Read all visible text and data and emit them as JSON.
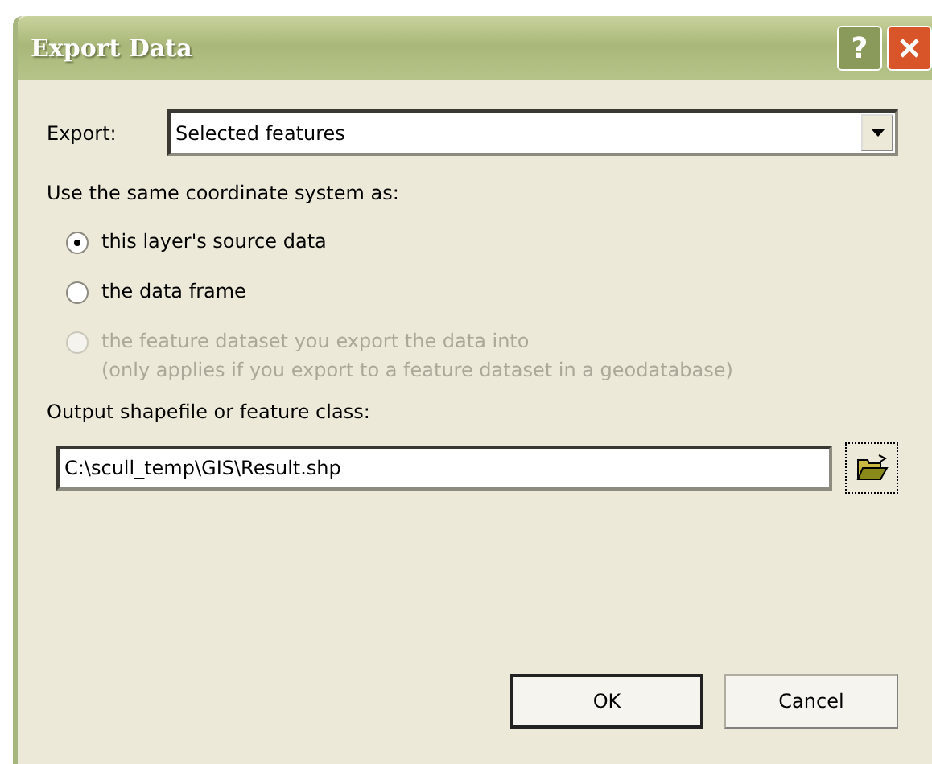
{
  "window": {
    "title": "Export Data",
    "title_buttons": [
      {
        "kind": "help",
        "label": "?"
      },
      {
        "kind": "close"
      }
    ]
  },
  "export": {
    "label": "Export:",
    "value": "Selected features"
  },
  "coordinate_system": {
    "label": "Use the same coordinate system as:",
    "options": [
      {
        "label": "this layer's source data",
        "selected": true,
        "disabled": false
      },
      {
        "label": "the data frame",
        "selected": false,
        "disabled": false
      },
      {
        "label": "the feature dataset you export the data into",
        "note": "(only applies if you export to a feature dataset in a geodatabase)",
        "selected": false,
        "disabled": true
      }
    ]
  },
  "output": {
    "label": "Output shapefile or feature class:",
    "value": "C:\\scull_temp\\GIS\\Result.shp"
  },
  "buttons": [
    {
      "label": "OK",
      "default": true
    },
    {
      "label": "Cancel",
      "default": false
    }
  ]
}
